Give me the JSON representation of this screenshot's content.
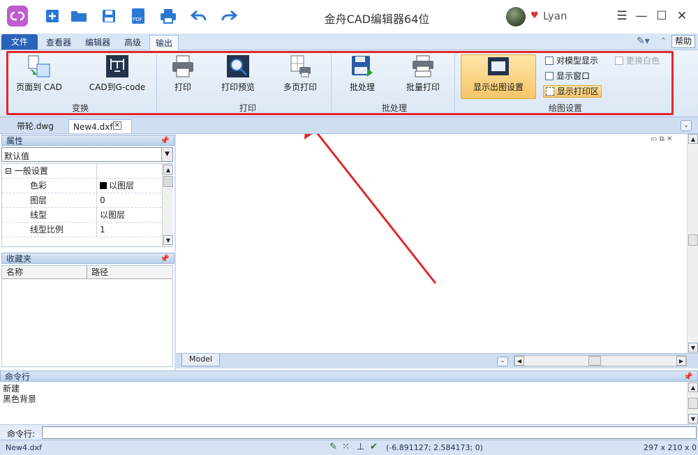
{
  "app": {
    "title": "金舟CAD编辑器64位",
    "username": "Lyan"
  },
  "ribbon_tabs": [
    {
      "label": "文件"
    },
    {
      "label": "查看器"
    },
    {
      "label": "编辑器"
    },
    {
      "label": "高级"
    },
    {
      "label": "输出"
    }
  ],
  "help_label": "帮助",
  "ribbon": {
    "buttons": [
      {
        "label": "页面到 CAD"
      },
      {
        "label": "CAD到G-code"
      },
      {
        "label": "打印"
      },
      {
        "label": "打印预览"
      },
      {
        "label": "多页打印"
      },
      {
        "label": "批处理"
      },
      {
        "label": "批量打印"
      },
      {
        "label": "显示出图设置"
      }
    ],
    "groups": [
      "变换",
      "打印",
      "批处理",
      "绘图设置"
    ],
    "options": [
      "对模型显示",
      "显示窗口",
      "显示打印区",
      "更换白色"
    ]
  },
  "doc_tabs": [
    {
      "label": "带轮.dwg"
    },
    {
      "label": "New4.dxf"
    }
  ],
  "properties": {
    "title": "属性",
    "dropdown_value": "默认值",
    "section": "一般设置",
    "rows": [
      {
        "key": "色彩",
        "value": "以图层"
      },
      {
        "key": "图层",
        "value": "0"
      },
      {
        "key": "线型",
        "value": "以图层"
      },
      {
        "key": "线型比例",
        "value": "1"
      }
    ]
  },
  "favorites": {
    "title": "收藏夹",
    "col1": "名称",
    "col2": "路径"
  },
  "model_tab": "Model",
  "command": {
    "title": "命令行",
    "history": [
      "新建",
      "黑色背景"
    ],
    "input_label": "命令行:"
  },
  "status": {
    "file": "New4.dxf",
    "coords": "(-6.891127; 2.584173; 0)",
    "paper": "297 x 210 x 0"
  },
  "colors": {
    "accent": "#e0282a",
    "brand": "#2a63b8",
    "highlight": "#f7d38a"
  }
}
